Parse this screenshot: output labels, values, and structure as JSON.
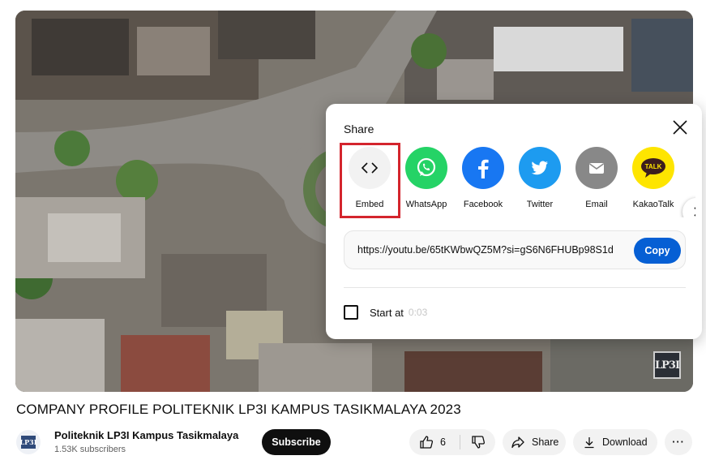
{
  "video": {
    "watermark_text": "LP3I"
  },
  "share_dialog": {
    "title": "Share",
    "close_icon": "close-icon",
    "targets": [
      {
        "label": "Embed",
        "icon": "embed-code-icon",
        "color": "#f2f2f2"
      },
      {
        "label": "WhatsApp",
        "icon": "whatsapp-icon",
        "color": "#25d366"
      },
      {
        "label": "Facebook",
        "icon": "facebook-icon",
        "color": "#1877f2"
      },
      {
        "label": "Twitter",
        "icon": "twitter-icon",
        "color": "#1d9bf0"
      },
      {
        "label": "Email",
        "icon": "email-icon",
        "color": "#888888"
      },
      {
        "label": "KakaoTalk",
        "icon": "kakaotalk-icon",
        "color": "#fee500"
      }
    ],
    "kakao_badge": "TALK",
    "next_icon": "chevron-right-icon",
    "url": "https://youtu.be/65tKWbwQZ5M?si=gS6N6FHUBp98S1d",
    "copy_label": "Copy",
    "start_at_label": "Start at",
    "start_at_time": "0:03",
    "highlight_color": "#d4252d"
  },
  "title": "COMPANY PROFILE POLITEKNIK LP3I KAMPUS TASIKMALAYA 2023",
  "channel": {
    "name": "Politeknik LP3I Kampus Tasikmalaya",
    "subscribers": "1.53K subscribers",
    "avatar_text": "LP3I",
    "subscribe_label": "Subscribe"
  },
  "actions": {
    "like_count": "6",
    "share_label": "Share",
    "download_label": "Download",
    "more_label": "···"
  }
}
